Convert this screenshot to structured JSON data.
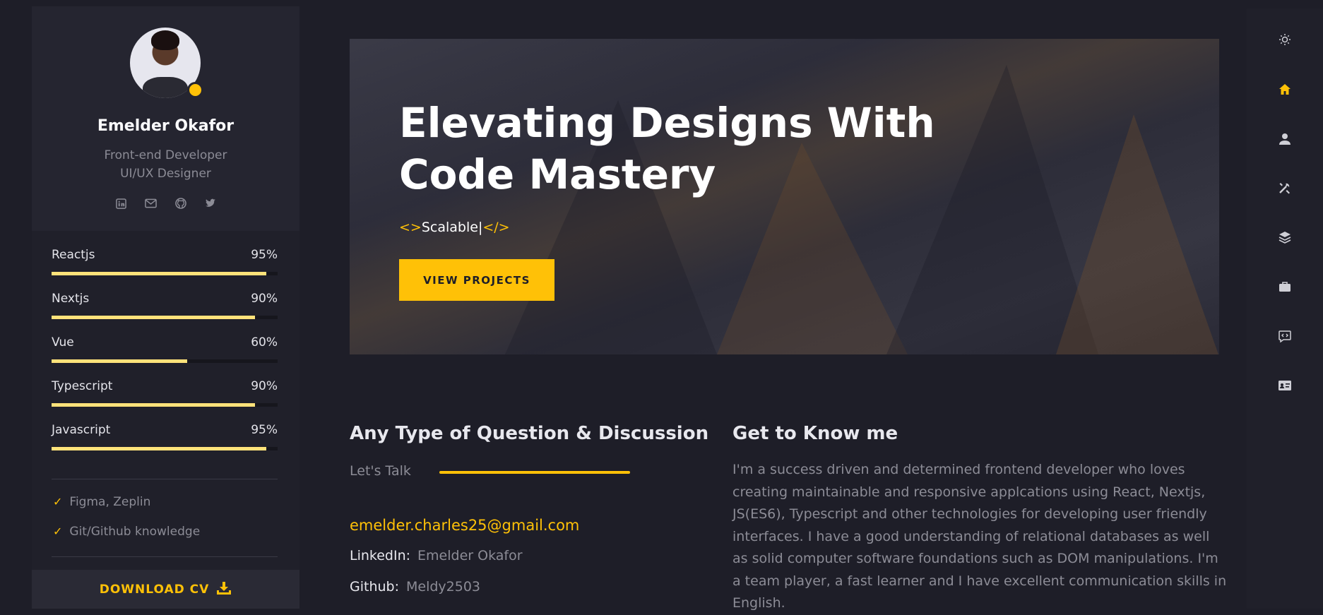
{
  "profile": {
    "name": "Emelder Okafor",
    "role_line1": "Front-end Developer",
    "role_line2": "UI/UX Designer",
    "socials": [
      "linkedin-icon",
      "mail-icon",
      "github-icon",
      "twitter-icon"
    ]
  },
  "skills": [
    {
      "label": "Reactjs",
      "percent": "95%",
      "value": 95
    },
    {
      "label": "Nextjs",
      "percent": "90%",
      "value": 90
    },
    {
      "label": "Vue",
      "percent": "60%",
      "value": 60
    },
    {
      "label": "Typescript",
      "percent": "90%",
      "value": 90
    },
    {
      "label": "Javascript",
      "percent": "95%",
      "value": 95
    }
  ],
  "extras": [
    "Figma, Zeplin",
    "Git/Github knowledge"
  ],
  "download_label": "DOWNLOAD CV",
  "hero": {
    "title_line1": "Elevating Designs With",
    "title_line2": "Code Mastery",
    "typed_open": "<>",
    "typed_text": "Scalable|",
    "typed_close": "</>",
    "button_label": "VIEW PROJECTS"
  },
  "contact": {
    "heading": "Any Type of Question & Discussion",
    "talk_label": "Let's Talk",
    "email": "emelder.charles25@gmail.com",
    "linkedin_key": "LinkedIn:",
    "linkedin_value": "Emelder Okafor",
    "github_key": "Github:",
    "github_value": "Meldy2503"
  },
  "about": {
    "heading": "Get to Know me",
    "text": "I'm a success driven and determined frontend developer who loves creating maintainable and responsive applcations using React, Nextjs, JS(ES6), Typescript and other technologies for developing user friendly interfaces. I have a good understanding of relational databases as well as solid computer software foundations such as DOM manipulations. I'm a team player, a fast learner and I have excellent communication skills in English."
  },
  "nav": [
    "sun-icon",
    "home-icon",
    "user-icon",
    "tools-icon",
    "layers-icon",
    "briefcase-icon",
    "chat-code-icon",
    "contact-card-icon"
  ],
  "colors": {
    "accent": "#ffc107",
    "bar": "#ffe27a",
    "bg": "#1e1e28"
  }
}
